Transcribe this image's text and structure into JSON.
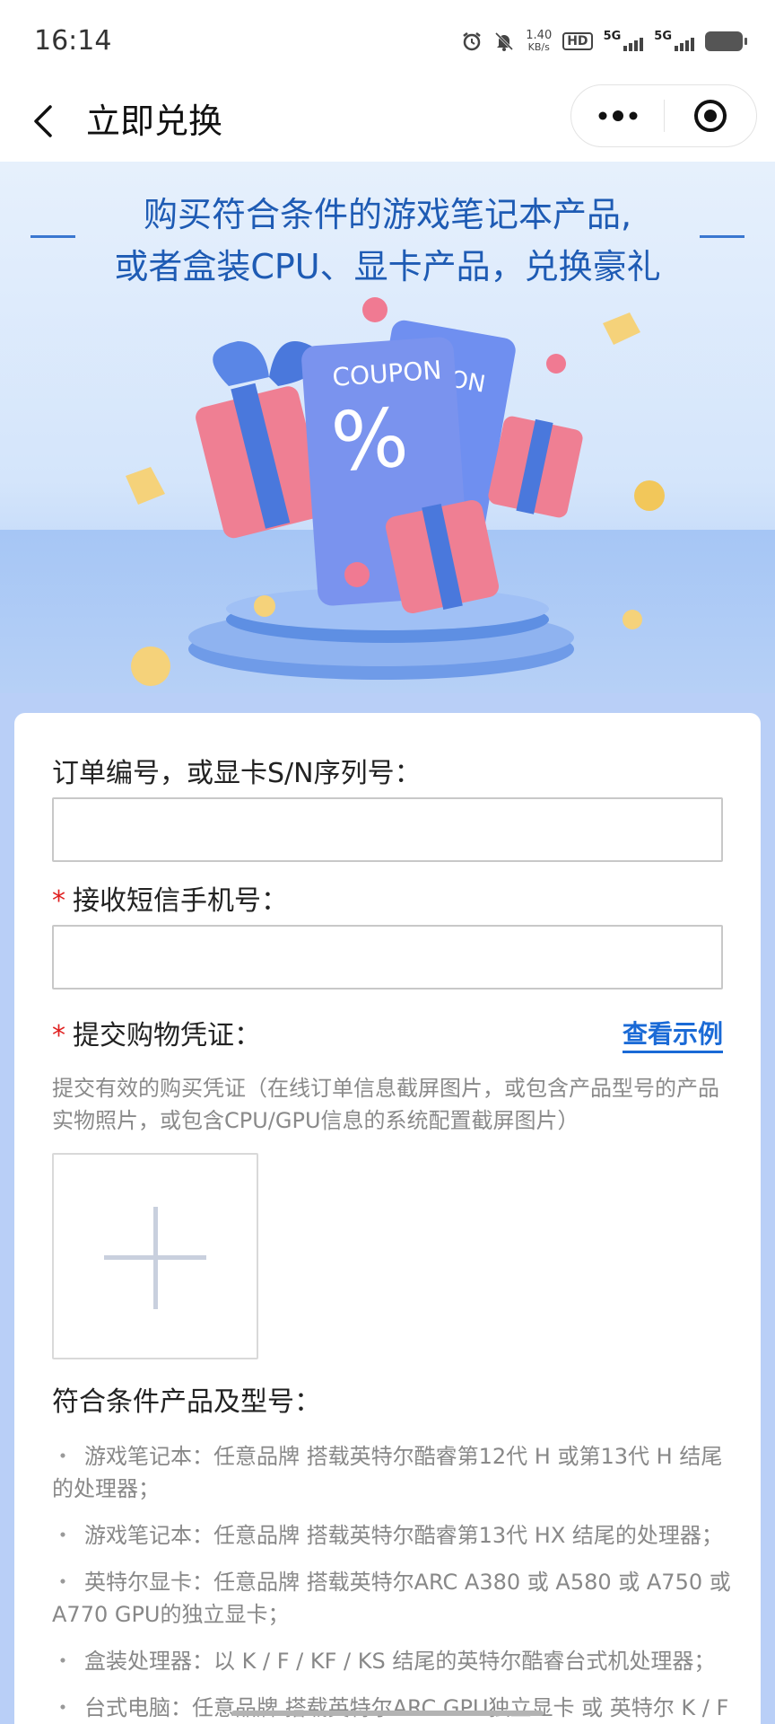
{
  "status_bar": {
    "time": "16:14",
    "net_speed_value": "1.40",
    "net_speed_unit": "KB/s",
    "hd_label": "HD",
    "sim1_type": "5G",
    "sim2_type": "5G"
  },
  "nav": {
    "title": "立即兑换"
  },
  "banner": {
    "line1": "购买符合条件的游戏笔记本产品,",
    "line2": "或者盒装CPU、显卡产品，兑换豪礼",
    "coupon_text": "COUPON",
    "coupon_symbol": "%",
    "coupon_back_text": "ON"
  },
  "form": {
    "order_label": "订单编号，或显卡S/N序列号：",
    "order_value": "",
    "phone_required_mark": "*",
    "phone_label": "接收短信手机号：",
    "phone_value": "",
    "proof_required_mark": "*",
    "proof_label": "提交购物凭证：",
    "view_example": "查看示例",
    "proof_hint": "提交有效的购买凭证（在线订单信息截屏图片，或包含产品型号的产品实物照片，或包含CPU/GPU信息的系统配置截屏图片）",
    "eligible_title": "符合条件产品及型号：",
    "eligible_items": [
      "游戏笔记本：任意品牌 搭载英特尔酷睿第12代 H 或第13代 H 结尾的处理器；",
      "游戏笔记本：任意品牌 搭载英特尔酷睿第13代 HX 结尾的处理器；",
      "英特尔显卡：任意品牌 搭载英特尔ARC A380 或 A580 或 A750 或 A770 GPU的独立显卡；",
      "盒装处理器：以 K / F / KF / KS 结尾的英特尔酷睿台式机处理器；",
      "台式电脑：任意品牌 搭载英特尔ARC GPU独立显卡 或 英特尔 K / F /"
    ],
    "bullet": "・"
  },
  "colors": {
    "accent": "#1a6ad6",
    "banner_title": "#1e5bb4",
    "required": "#e02020",
    "page_bg": "#b9cff7"
  }
}
